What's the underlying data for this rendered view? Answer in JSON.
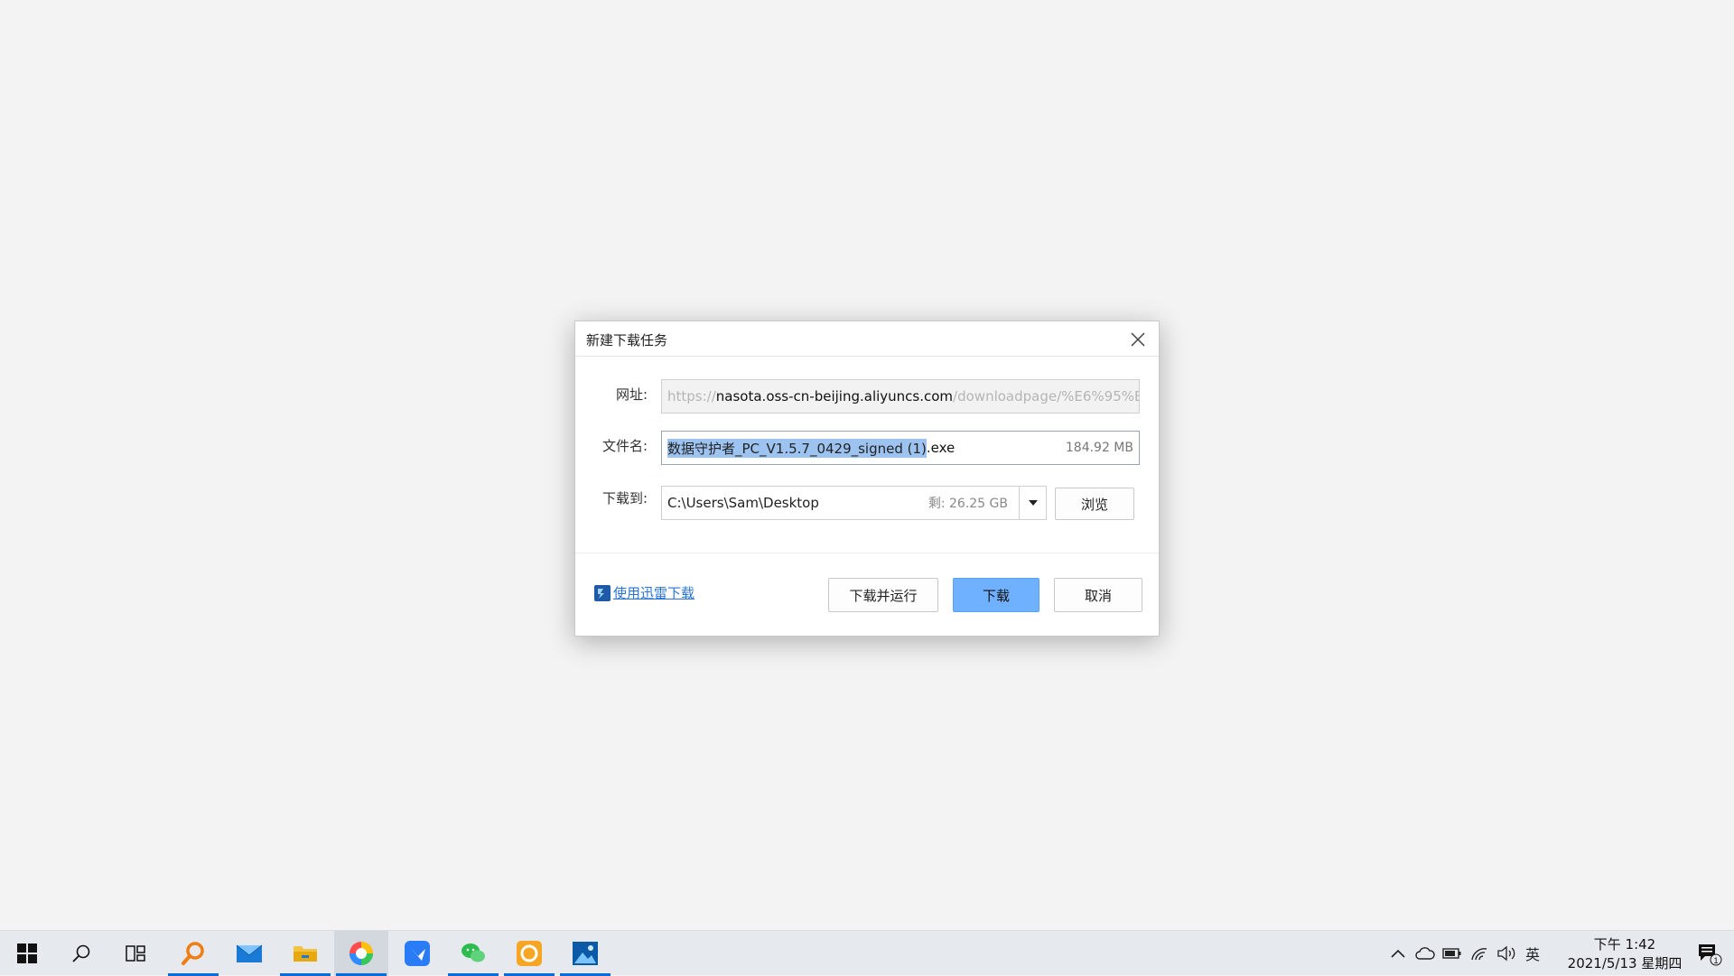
{
  "dialog": {
    "title": "新建下载任务",
    "url_label": "网址:",
    "url": {
      "scheme": "https://",
      "host": "nasota.oss-cn-beijing.aliyuncs.com",
      "path": "/downloadpage/%E6%95%B"
    },
    "filename_label": "文件名:",
    "filename": {
      "selected": "数据守护者_PC_V1.5.7_0429_signed (1)",
      "ext": ".exe",
      "size": "184.92 MB"
    },
    "saveto_label": "下载到:",
    "saveto": {
      "path": "C:\\Users\\Sam\\Desktop",
      "free": "剩: 26.25 GB"
    },
    "browse_label": "浏览",
    "xunlei_link": "使用迅雷下载",
    "download_run_label": "下载并运行",
    "download_label": "下载",
    "cancel_label": "取消"
  },
  "taskbar": {
    "apps": [
      "start-icon",
      "search-icon",
      "task-view-icon",
      "search-app-icon",
      "mail-icon",
      "file-explorer-icon",
      "browser-icon",
      "feishu-icon",
      "wechat-icon",
      "orange-app-icon",
      "photos-icon"
    ],
    "tray": {
      "ime": "英"
    },
    "clock": {
      "time": "下午 1:42",
      "date": "2021/5/13 星期四"
    },
    "notifications": "1"
  },
  "colors": {
    "primary_button": "#6fb0ff",
    "link": "#2a73d6",
    "selection": "#9dc3f1",
    "taskbar_indicator": "#0a6cd6"
  }
}
